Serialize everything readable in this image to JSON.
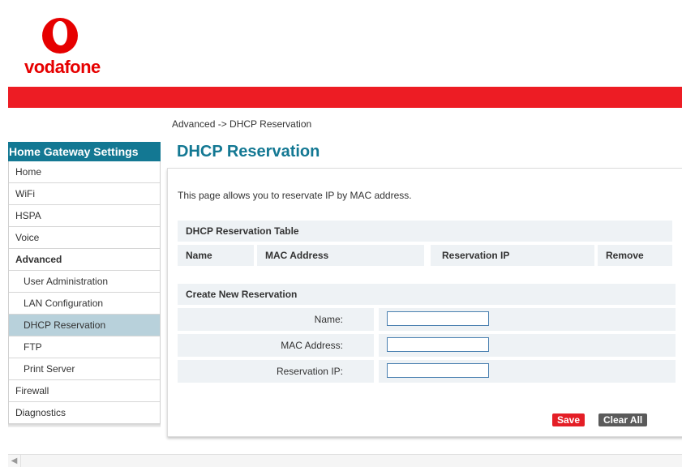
{
  "brand": {
    "name": "vodafone",
    "color": "#e60000"
  },
  "breadcrumb": "Advanced -> DHCP Reservation",
  "sidebar": {
    "title": "Home Gateway Settings",
    "items": [
      {
        "label": "Home"
      },
      {
        "label": "WiFi"
      },
      {
        "label": "HSPA"
      },
      {
        "label": "Voice"
      },
      {
        "label": "Advanced"
      },
      {
        "label": "User Administration"
      },
      {
        "label": "LAN Configuration"
      },
      {
        "label": "DHCP Reservation"
      },
      {
        "label": "FTP"
      },
      {
        "label": "Print Server"
      },
      {
        "label": "Firewall"
      },
      {
        "label": "Diagnostics"
      }
    ]
  },
  "main": {
    "title": "DHCP Reservation",
    "intro": "This page allows you to reservate IP by MAC address.",
    "table": {
      "title": "DHCP Reservation Table",
      "columns": [
        "Name",
        "MAC Address",
        "Reservation IP",
        "Remove"
      ]
    },
    "create": {
      "title": "Create New Reservation",
      "fields": [
        {
          "label": "Name:",
          "value": ""
        },
        {
          "label": "MAC Address:",
          "value": ""
        },
        {
          "label": "Reservation IP:",
          "value": ""
        }
      ]
    },
    "buttons": {
      "save": "Save",
      "clear": "Clear All"
    }
  },
  "icons": {
    "scroll_left": "chevron-left-icon"
  },
  "colors": {
    "accent": "#137893",
    "red_bar": "#ed1c24",
    "active_item": "#b8d1db"
  }
}
